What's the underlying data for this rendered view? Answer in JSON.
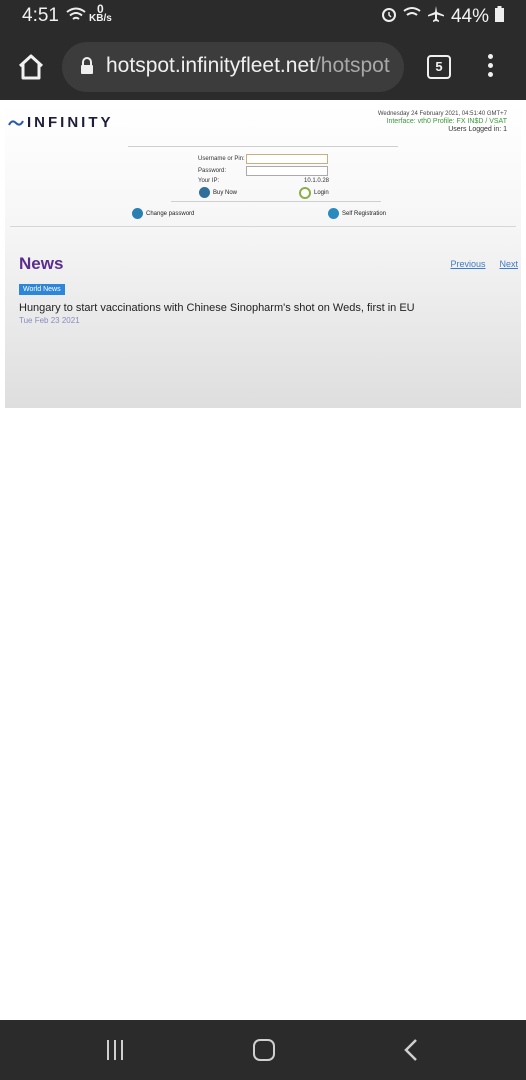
{
  "status_bar": {
    "time": "4:51",
    "net_speed_value": "0",
    "net_speed_unit": "KB/s",
    "battery": "44%"
  },
  "browser": {
    "url_domain": "hotspot.infinityfleet.net",
    "url_path": "/hotspot",
    "tab_count": "5"
  },
  "page": {
    "logo_text": "INFINITY",
    "datetime": "Wednesday 24 February 2021, 04:51:40 GMT+7",
    "interface": "Interface: vth0 Profile: FX IN$D / VSAT",
    "users_logged_in": "Users Logged in: 1",
    "username_label": "Username or Pin:",
    "password_label": "Password:",
    "your_ip_label": "Your IP:",
    "your_ip_value": "10.1.0.28",
    "buy_now": "Buy Now",
    "login": "Login",
    "change_password": "Change password",
    "self_registration": "Self Registration",
    "news_heading": "News",
    "previous": "Previous",
    "next": "Next",
    "badge": "World News",
    "headline": "Hungary to start vaccinations with Chinese Sinopharm's shot on Weds, first in EU",
    "news_date": "Tue Feb 23 2021"
  },
  "colors": {
    "accent_purple": "#5b2d8e",
    "link_blue": "#3f7cc6",
    "badge_blue": "#2d86d8",
    "status_green": "#3a9a3a"
  }
}
